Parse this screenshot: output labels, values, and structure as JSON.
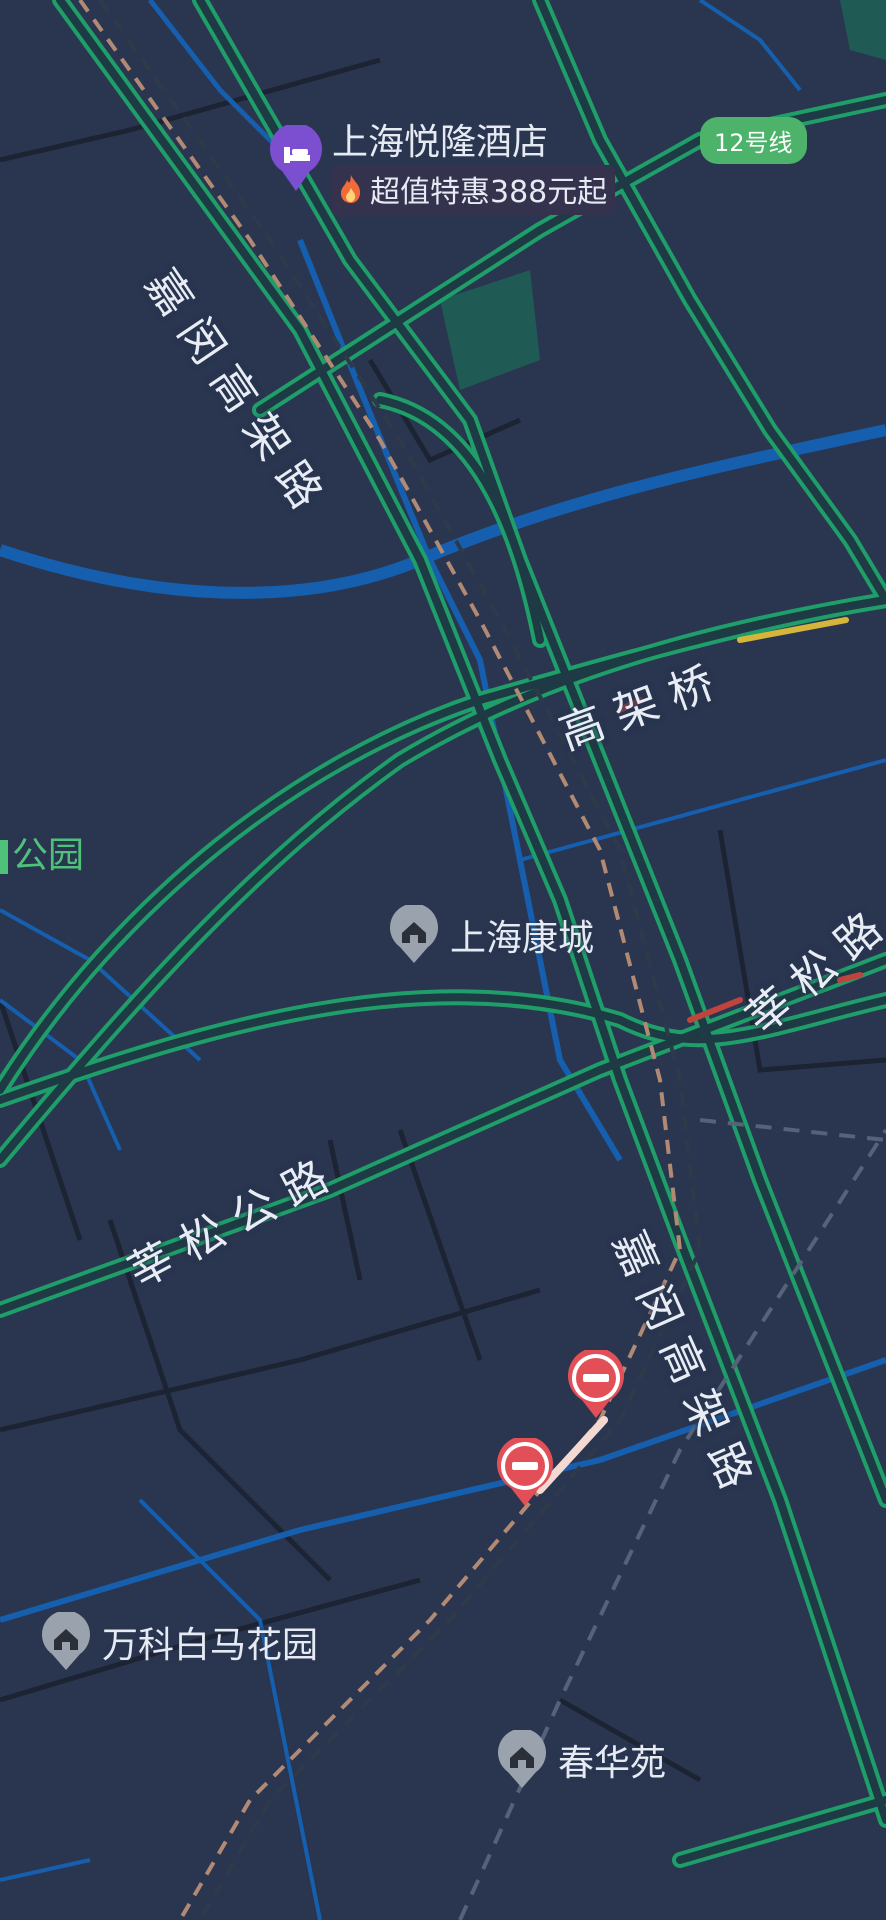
{
  "map": {
    "colors": {
      "background": "#2a3650",
      "road_fill": "#1f3b44",
      "road_edge": "#1f9e6a",
      "water": "#155fae",
      "block_line": "#1c2333",
      "rail": "#b28a74"
    },
    "road_labels": {
      "jiamin_north": "嘉闵高架路",
      "gaojiaqiao": "高架桥",
      "xinsong_road_east": "莘松路",
      "xinsong_gonglu": "莘松公路",
      "jiamin_south": "嘉闵高架路"
    },
    "hotel": {
      "name": "上海悦隆酒店",
      "promo": "超值特惠388元起",
      "icon": "bed-icon",
      "promo_icon": "fire-icon"
    },
    "metro_badge": "12号线",
    "park_label": "公园",
    "pois": [
      {
        "name": "上海康城",
        "icon": "residential-icon"
      },
      {
        "name": "万科白马花园",
        "icon": "residential-icon"
      },
      {
        "name": "春华苑",
        "icon": "residential-icon"
      }
    ],
    "closure_markers": [
      {
        "icon": "no-entry-icon"
      },
      {
        "icon": "no-entry-icon"
      }
    ]
  }
}
